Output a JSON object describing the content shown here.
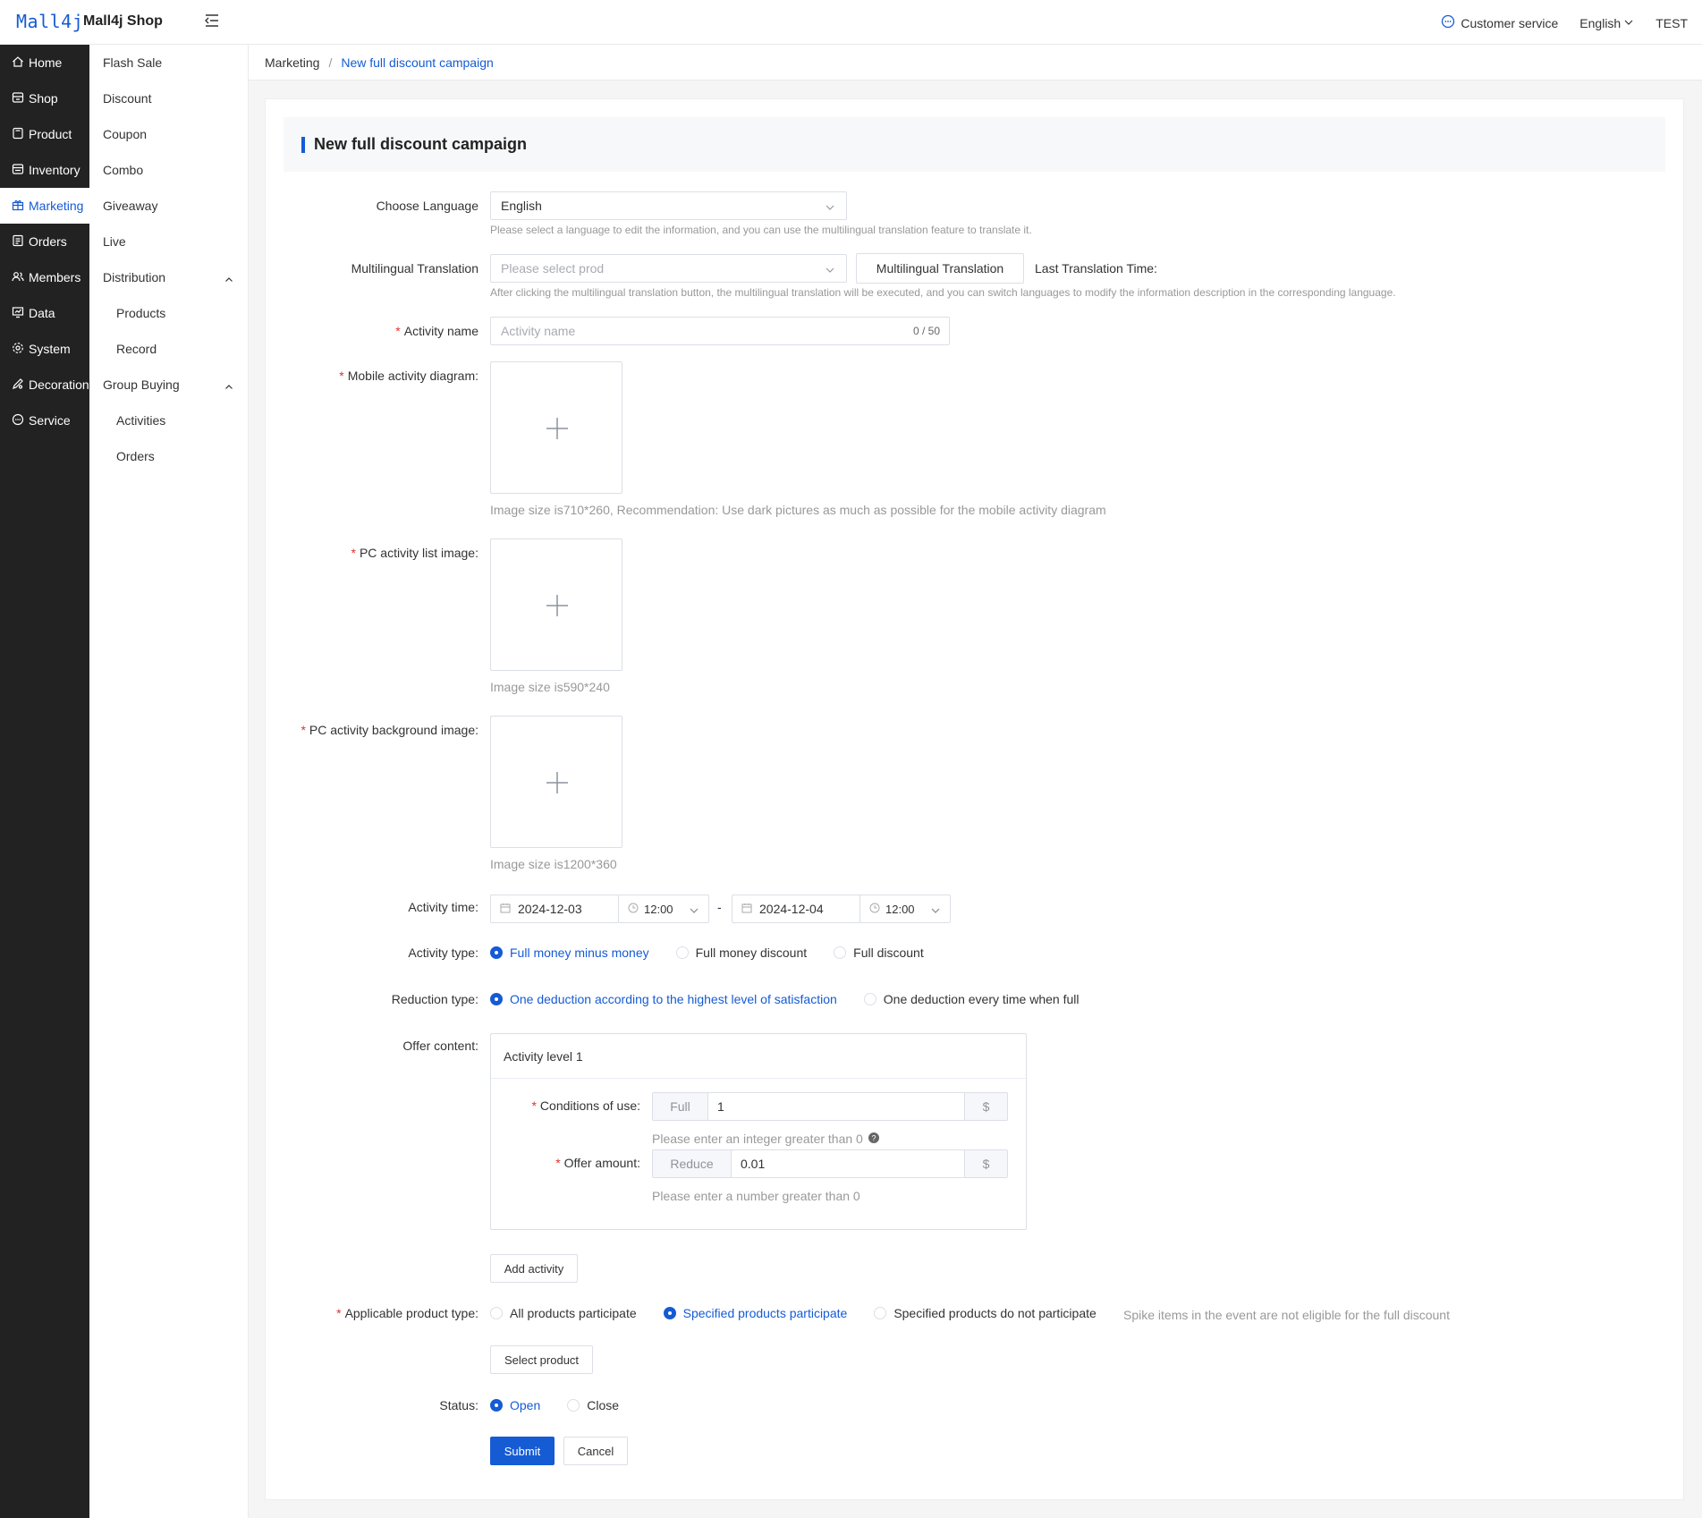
{
  "header": {
    "logo": "Mall4j",
    "shop_name": "Mall4j Shop",
    "customer_service": "Customer service",
    "language": "English",
    "user": "TEST"
  },
  "sidebar": {
    "items": [
      {
        "label": "Home",
        "icon": "home-icon"
      },
      {
        "label": "Shop",
        "icon": "shop-icon"
      },
      {
        "label": "Product",
        "icon": "product-icon"
      },
      {
        "label": "Inventory",
        "icon": "inventory-icon"
      },
      {
        "label": "Marketing",
        "icon": "gift-icon",
        "active": true
      },
      {
        "label": "Orders",
        "icon": "orders-icon"
      },
      {
        "label": "Members",
        "icon": "members-icon"
      },
      {
        "label": "Data",
        "icon": "data-icon"
      },
      {
        "label": "System",
        "icon": "gear-icon"
      },
      {
        "label": "Decoration",
        "icon": "brush-icon"
      },
      {
        "label": "Service",
        "icon": "chat-icon"
      }
    ]
  },
  "subnav": {
    "items": [
      {
        "label": "Flash Sale"
      },
      {
        "label": "Discount"
      },
      {
        "label": "Coupon"
      },
      {
        "label": "Combo"
      },
      {
        "label": "Giveaway"
      },
      {
        "label": "Live"
      },
      {
        "label": "Distribution"
      },
      {
        "label": "Products"
      },
      {
        "label": "Record"
      },
      {
        "label": "Group Buying"
      },
      {
        "label": "Activities"
      },
      {
        "label": "Orders"
      }
    ]
  },
  "breadcrumb": {
    "parent": "Marketing",
    "separator": "/",
    "current": "New full discount campaign"
  },
  "form": {
    "title": "New full discount campaign",
    "language": {
      "label": "Choose Language",
      "value": "English",
      "hint": "Please select a language to edit the information, and you can use the multilingual translation feature to translate it."
    },
    "translation": {
      "label": "Multilingual Translation",
      "placeholder": "Please select prod",
      "button": "Multilingual Translation",
      "last_time_label": "Last Translation Time:",
      "hint": "After clicking the multilingual translation button, the multilingual translation will be executed, and you can switch languages to modify the information description in the corresponding language."
    },
    "activity_name": {
      "label": "Activity name",
      "placeholder": "Activity name",
      "counter": "0 / 50"
    },
    "mobile_diagram": {
      "label": "Mobile activity diagram:",
      "hint": "Image size is710*260,  Recommendation: Use dark pictures as much as possible for the mobile activity diagram"
    },
    "pc_list_image": {
      "label": "PC activity list image:",
      "hint": "Image size is590*240"
    },
    "pc_background": {
      "label": "PC activity background image:",
      "hint": "Image size is1200*360"
    },
    "activity_time": {
      "label": "Activity time:",
      "start_date": "2024-12-03",
      "start_time": "12:00",
      "separator": "-",
      "end_date": "2024-12-04",
      "end_time": "12:00"
    },
    "activity_type": {
      "label": "Activity type:",
      "options": [
        "Full money minus money",
        "Full money discount",
        "Full discount"
      ],
      "selected": 0
    },
    "reduction_type": {
      "label": "Reduction type:",
      "options": [
        "One deduction according to the highest level of satisfaction",
        "One deduction every time when full"
      ],
      "selected": 0
    },
    "offer": {
      "label": "Offer content:",
      "level_title": "Activity level 1",
      "conditions_label": "Conditions of use:",
      "conditions_prefix": "Full",
      "conditions_value": "1",
      "conditions_suffix": "$",
      "conditions_hint": "Please enter an integer greater than 0",
      "amount_label": "Offer amount:",
      "amount_prefix": "Reduce",
      "amount_value": "0.01",
      "amount_suffix": "$",
      "amount_hint": "Please enter a number greater than 0",
      "add_button": "Add activity"
    },
    "product_type": {
      "label": "Applicable product type:",
      "options": [
        "All products participate",
        "Specified products participate",
        "Specified products do not participate"
      ],
      "selected": 1,
      "note": "Spike items in the event are not eligible for the full discount",
      "select_button": "Select product"
    },
    "status": {
      "label": "Status:",
      "options": [
        "Open",
        "Close"
      ],
      "selected": 0
    },
    "submit": "Submit",
    "cancel": "Cancel"
  },
  "colors": {
    "primary": "#155bd4",
    "sidebar_bg": "#222222",
    "required": "#e43130"
  }
}
